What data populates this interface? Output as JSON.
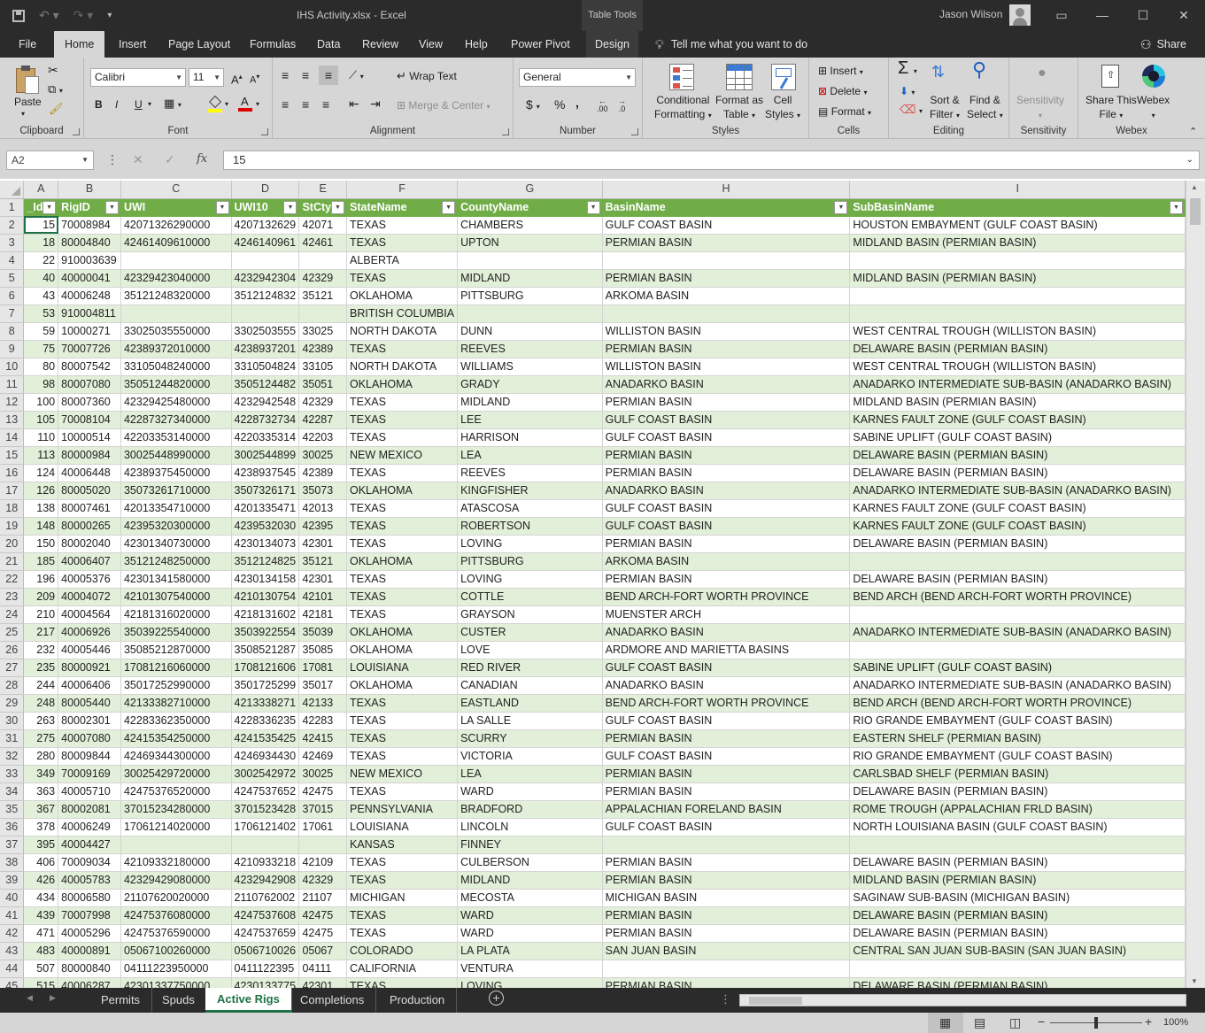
{
  "title": {
    "filename": "IHS Activity.xlsx",
    "separator": " - ",
    "app": "Excel",
    "context_tab": "Table Tools",
    "user": "Jason Wilson"
  },
  "menu_tabs": [
    "File",
    "Home",
    "Insert",
    "Page Layout",
    "Formulas",
    "Data",
    "Review",
    "View",
    "Help",
    "Power Pivot",
    "Design"
  ],
  "tell_me": "Tell me what you want to do",
  "share": "Share",
  "ribbon": {
    "clipboard": {
      "label": "Clipboard",
      "paste": "Paste"
    },
    "font": {
      "label": "Font",
      "name": "Calibri",
      "size": "11",
      "bold": "B",
      "italic": "I",
      "underline": "U"
    },
    "alignment": {
      "label": "Alignment",
      "wrap": "Wrap Text",
      "merge": "Merge & Center"
    },
    "number": {
      "label": "Number",
      "format": "General",
      "currency": "$",
      "percent": "%",
      "comma": ",",
      "inc_decimal": ".00",
      "dec_decimal": ".0"
    },
    "styles": {
      "label": "Styles",
      "conditional_1": "Conditional",
      "conditional_2": "Formatting",
      "format_table_1": "Format as",
      "format_table_2": "Table",
      "cell_styles_1": "Cell",
      "cell_styles_2": "Styles"
    },
    "cells": {
      "label": "Cells",
      "insert": "Insert",
      "delete": "Delete",
      "format": "Format"
    },
    "editing": {
      "label": "Editing",
      "sort_1": "Sort &",
      "sort_2": "Filter",
      "find_1": "Find &",
      "find_2": "Select"
    },
    "sensitivity": {
      "label": "Sensitivity",
      "btn": "Sensitivity"
    },
    "webex": {
      "label": "Webex",
      "share_1": "Share This",
      "share_2": "File",
      "webex": "Webex"
    }
  },
  "formula_bar": {
    "name_box": "A2",
    "fx": "fx",
    "value": "15"
  },
  "columns": [
    "A",
    "B",
    "C",
    "D",
    "E",
    "F",
    "G",
    "H",
    "I"
  ],
  "headers": [
    "_Id",
    "RigID",
    "UWI",
    "UWI10",
    "StCty",
    "StateName",
    "CountyName",
    "BasinName",
    "SubBasinName"
  ],
  "rows": [
    [
      "15",
      "70008984",
      "42071326290000",
      "4207132629",
      "42071",
      "TEXAS",
      "CHAMBERS",
      "GULF COAST BASIN",
      "HOUSTON EMBAYMENT (GULF COAST BASIN)"
    ],
    [
      "18",
      "80004840",
      "42461409610000",
      "4246140961",
      "42461",
      "TEXAS",
      "UPTON",
      "PERMIAN BASIN",
      "MIDLAND BASIN (PERMIAN BASIN)"
    ],
    [
      "22",
      "910003639",
      "",
      "",
      "",
      "ALBERTA",
      "",
      "",
      ""
    ],
    [
      "40",
      "40000041",
      "42329423040000",
      "4232942304",
      "42329",
      "TEXAS",
      "MIDLAND",
      "PERMIAN BASIN",
      "MIDLAND BASIN (PERMIAN BASIN)"
    ],
    [
      "43",
      "40006248",
      "35121248320000",
      "3512124832",
      "35121",
      "OKLAHOMA",
      "PITTSBURG",
      "ARKOMA BASIN",
      ""
    ],
    [
      "53",
      "910004811",
      "",
      "",
      "",
      "BRITISH COLUMBIA",
      "",
      "",
      ""
    ],
    [
      "59",
      "10000271",
      "33025035550000",
      "3302503555",
      "33025",
      "NORTH DAKOTA",
      "DUNN",
      "WILLISTON BASIN",
      "WEST CENTRAL TROUGH (WILLISTON BASIN)"
    ],
    [
      "75",
      "70007726",
      "42389372010000",
      "4238937201",
      "42389",
      "TEXAS",
      "REEVES",
      "PERMIAN BASIN",
      "DELAWARE BASIN (PERMIAN BASIN)"
    ],
    [
      "80",
      "80007542",
      "33105048240000",
      "3310504824",
      "33105",
      "NORTH DAKOTA",
      "WILLIAMS",
      "WILLISTON BASIN",
      "WEST CENTRAL TROUGH (WILLISTON BASIN)"
    ],
    [
      "98",
      "80007080",
      "35051244820000",
      "3505124482",
      "35051",
      "OKLAHOMA",
      "GRADY",
      "ANADARKO BASIN",
      "ANADARKO INTERMEDIATE SUB-BASIN (ANADARKO BASIN)"
    ],
    [
      "100",
      "80007360",
      "42329425480000",
      "4232942548",
      "42329",
      "TEXAS",
      "MIDLAND",
      "PERMIAN BASIN",
      "MIDLAND BASIN (PERMIAN BASIN)"
    ],
    [
      "105",
      "70008104",
      "42287327340000",
      "4228732734",
      "42287",
      "TEXAS",
      "LEE",
      "GULF COAST BASIN",
      "KARNES FAULT ZONE (GULF COAST BASIN)"
    ],
    [
      "110",
      "10000514",
      "42203353140000",
      "4220335314",
      "42203",
      "TEXAS",
      "HARRISON",
      "GULF COAST BASIN",
      "SABINE UPLIFT (GULF COAST BASIN)"
    ],
    [
      "113",
      "80000984",
      "30025448990000",
      "3002544899",
      "30025",
      "NEW MEXICO",
      "LEA",
      "PERMIAN BASIN",
      "DELAWARE BASIN (PERMIAN BASIN)"
    ],
    [
      "124",
      "40006448",
      "42389375450000",
      "4238937545",
      "42389",
      "TEXAS",
      "REEVES",
      "PERMIAN BASIN",
      "DELAWARE BASIN (PERMIAN BASIN)"
    ],
    [
      "126",
      "80005020",
      "35073261710000",
      "3507326171",
      "35073",
      "OKLAHOMA",
      "KINGFISHER",
      "ANADARKO BASIN",
      "ANADARKO INTERMEDIATE SUB-BASIN (ANADARKO BASIN)"
    ],
    [
      "138",
      "80007461",
      "42013354710000",
      "4201335471",
      "42013",
      "TEXAS",
      "ATASCOSA",
      "GULF COAST BASIN",
      "KARNES FAULT ZONE (GULF COAST BASIN)"
    ],
    [
      "148",
      "80000265",
      "42395320300000",
      "4239532030",
      "42395",
      "TEXAS",
      "ROBERTSON",
      "GULF COAST BASIN",
      "KARNES FAULT ZONE (GULF COAST BASIN)"
    ],
    [
      "150",
      "80002040",
      "42301340730000",
      "4230134073",
      "42301",
      "TEXAS",
      "LOVING",
      "PERMIAN BASIN",
      "DELAWARE BASIN (PERMIAN BASIN)"
    ],
    [
      "185",
      "40006407",
      "35121248250000",
      "3512124825",
      "35121",
      "OKLAHOMA",
      "PITTSBURG",
      "ARKOMA BASIN",
      ""
    ],
    [
      "196",
      "40005376",
      "42301341580000",
      "4230134158",
      "42301",
      "TEXAS",
      "LOVING",
      "PERMIAN BASIN",
      "DELAWARE BASIN (PERMIAN BASIN)"
    ],
    [
      "209",
      "40004072",
      "42101307540000",
      "4210130754",
      "42101",
      "TEXAS",
      "COTTLE",
      "BEND ARCH-FORT WORTH PROVINCE",
      "BEND ARCH (BEND ARCH-FORT WORTH PROVINCE)"
    ],
    [
      "210",
      "40004564",
      "42181316020000",
      "4218131602",
      "42181",
      "TEXAS",
      "GRAYSON",
      "MUENSTER ARCH",
      ""
    ],
    [
      "217",
      "40006926",
      "35039225540000",
      "3503922554",
      "35039",
      "OKLAHOMA",
      "CUSTER",
      "ANADARKO BASIN",
      "ANADARKO INTERMEDIATE SUB-BASIN (ANADARKO BASIN)"
    ],
    [
      "232",
      "40005446",
      "35085212870000",
      "3508521287",
      "35085",
      "OKLAHOMA",
      "LOVE",
      "ARDMORE AND MARIETTA BASINS",
      ""
    ],
    [
      "235",
      "80000921",
      "17081216060000",
      "1708121606",
      "17081",
      "LOUISIANA",
      "RED RIVER",
      "GULF COAST BASIN",
      "SABINE UPLIFT (GULF COAST BASIN)"
    ],
    [
      "244",
      "40006406",
      "35017252990000",
      "3501725299",
      "35017",
      "OKLAHOMA",
      "CANADIAN",
      "ANADARKO BASIN",
      "ANADARKO INTERMEDIATE SUB-BASIN (ANADARKO BASIN)"
    ],
    [
      "248",
      "80005440",
      "42133382710000",
      "4213338271",
      "42133",
      "TEXAS",
      "EASTLAND",
      "BEND ARCH-FORT WORTH PROVINCE",
      "BEND ARCH (BEND ARCH-FORT WORTH PROVINCE)"
    ],
    [
      "263",
      "80002301",
      "42283362350000",
      "4228336235",
      "42283",
      "TEXAS",
      "LA SALLE",
      "GULF COAST BASIN",
      "RIO GRANDE EMBAYMENT (GULF COAST BASIN)"
    ],
    [
      "275",
      "40007080",
      "42415354250000",
      "4241535425",
      "42415",
      "TEXAS",
      "SCURRY",
      "PERMIAN BASIN",
      "EASTERN SHELF (PERMIAN BASIN)"
    ],
    [
      "280",
      "80009844",
      "42469344300000",
      "4246934430",
      "42469",
      "TEXAS",
      "VICTORIA",
      "GULF COAST BASIN",
      "RIO GRANDE EMBAYMENT (GULF COAST BASIN)"
    ],
    [
      "349",
      "70009169",
      "30025429720000",
      "3002542972",
      "30025",
      "NEW MEXICO",
      "LEA",
      "PERMIAN BASIN",
      "CARLSBAD SHELF (PERMIAN BASIN)"
    ],
    [
      "363",
      "40005710",
      "42475376520000",
      "4247537652",
      "42475",
      "TEXAS",
      "WARD",
      "PERMIAN BASIN",
      "DELAWARE BASIN (PERMIAN BASIN)"
    ],
    [
      "367",
      "80002081",
      "37015234280000",
      "3701523428",
      "37015",
      "PENNSYLVANIA",
      "BRADFORD",
      "APPALACHIAN FORELAND BASIN",
      "ROME TROUGH (APPALACHIAN FRLD BASIN)"
    ],
    [
      "378",
      "40006249",
      "17061214020000",
      "1706121402",
      "17061",
      "LOUISIANA",
      "LINCOLN",
      "GULF COAST BASIN",
      "NORTH LOUISIANA BASIN (GULF COAST BASIN)"
    ],
    [
      "395",
      "40004427",
      "",
      "",
      "",
      "KANSAS",
      "FINNEY",
      "",
      ""
    ],
    [
      "406",
      "70009034",
      "42109332180000",
      "4210933218",
      "42109",
      "TEXAS",
      "CULBERSON",
      "PERMIAN BASIN",
      "DELAWARE BASIN (PERMIAN BASIN)"
    ],
    [
      "426",
      "40005783",
      "42329429080000",
      "4232942908",
      "42329",
      "TEXAS",
      "MIDLAND",
      "PERMIAN BASIN",
      "MIDLAND BASIN (PERMIAN BASIN)"
    ],
    [
      "434",
      "80006580",
      "21107620020000",
      "2110762002",
      "21107",
      "MICHIGAN",
      "MECOSTA",
      "MICHIGAN BASIN",
      "SAGINAW SUB-BASIN (MICHIGAN BASIN)"
    ],
    [
      "439",
      "70007998",
      "42475376080000",
      "4247537608",
      "42475",
      "TEXAS",
      "WARD",
      "PERMIAN BASIN",
      "DELAWARE BASIN (PERMIAN BASIN)"
    ],
    [
      "471",
      "40005296",
      "42475376590000",
      "4247537659",
      "42475",
      "TEXAS",
      "WARD",
      "PERMIAN BASIN",
      "DELAWARE BASIN (PERMIAN BASIN)"
    ],
    [
      "483",
      "40000891",
      "05067100260000",
      "0506710026",
      "05067",
      "COLORADO",
      "LA PLATA",
      "SAN JUAN BASIN",
      "CENTRAL SAN JUAN SUB-BASIN (SAN JUAN BASIN)"
    ],
    [
      "507",
      "80000840",
      "04111223950000",
      "0411122395",
      "04111",
      "CALIFORNIA",
      "VENTURA",
      "",
      ""
    ],
    [
      "515",
      "40006287",
      "42301337750000",
      "4230133775",
      "42301",
      "TEXAS",
      "LOVING",
      "PERMIAN BASIN",
      "DELAWARE BASIN (PERMIAN BASIN)"
    ]
  ],
  "sheets": [
    "Permits",
    "Spuds",
    "Active Rigs",
    "Completions",
    "Production"
  ],
  "active_sheet": "Active Rigs",
  "status": {
    "zoom": "100%"
  }
}
